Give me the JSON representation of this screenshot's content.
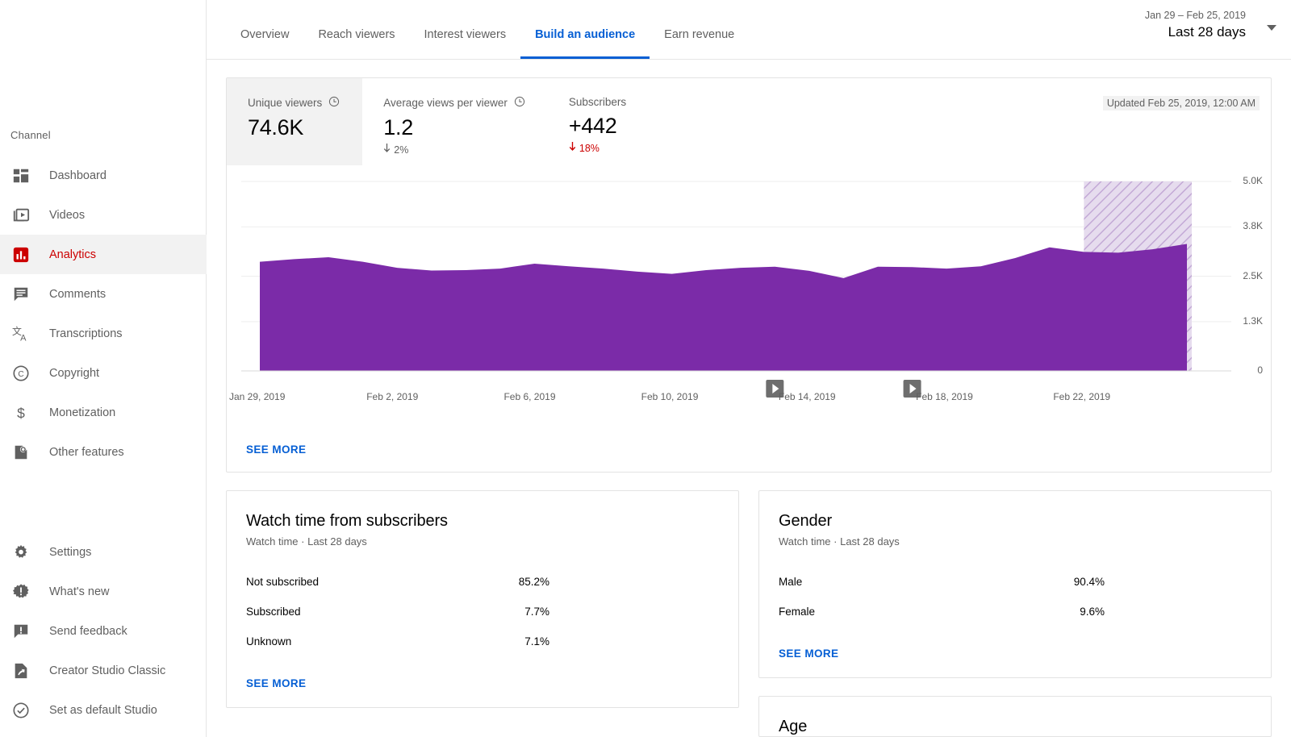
{
  "sidebar": {
    "section_label": "Channel",
    "top_items": [
      {
        "label": "Dashboard",
        "icon": "dashboard-icon",
        "active": false
      },
      {
        "label": "Videos",
        "icon": "videos-icon",
        "active": false
      },
      {
        "label": "Analytics",
        "icon": "analytics-icon",
        "active": true
      },
      {
        "label": "Comments",
        "icon": "comments-icon",
        "active": false
      },
      {
        "label": "Transcriptions",
        "icon": "transcriptions-icon",
        "active": false
      },
      {
        "label": "Copyright",
        "icon": "copyright-icon",
        "active": false
      },
      {
        "label": "Monetization",
        "icon": "monetization-icon",
        "active": false
      },
      {
        "label": "Other features",
        "icon": "other-features-icon",
        "active": false
      }
    ],
    "bottom_items": [
      {
        "label": "Settings",
        "icon": "gear-icon"
      },
      {
        "label": "What's new",
        "icon": "whats-new-icon"
      },
      {
        "label": "Send feedback",
        "icon": "feedback-icon"
      },
      {
        "label": "Creator Studio Classic",
        "icon": "creator-studio-classic-icon"
      },
      {
        "label": "Set as default Studio",
        "icon": "check-circle-icon"
      }
    ],
    "active_color": "#cc0000"
  },
  "header": {
    "tabs": [
      {
        "label": "Overview",
        "active": false
      },
      {
        "label": "Reach viewers",
        "active": false
      },
      {
        "label": "Interest viewers",
        "active": false
      },
      {
        "label": "Build an audience",
        "active": true
      },
      {
        "label": "Earn revenue",
        "active": false
      }
    ],
    "date_range_sub": "Jan 29 – Feb 25, 2019",
    "date_range_main": "Last 28 days",
    "accent_color": "#065fd4"
  },
  "chart_card": {
    "updated_text": "Updated Feb 25, 2019, 12:00 AM",
    "see_more": "SEE MORE",
    "metrics": [
      {
        "title": "Unique viewers",
        "value": "74.6K",
        "delta": "",
        "delta_dir": "",
        "has_info_icon": true,
        "selected": true
      },
      {
        "title": "Average views per viewer",
        "value": "1.2",
        "delta": "2%",
        "delta_dir": "down",
        "delta_style": "neutral",
        "has_info_icon": true,
        "selected": false
      },
      {
        "title": "Subscribers",
        "value": "+442",
        "delta": "18%",
        "delta_dir": "down",
        "delta_style": "down",
        "has_info_icon": false,
        "selected": false
      }
    ]
  },
  "chart_data": {
    "type": "area",
    "title": "Unique viewers",
    "xlabel": "",
    "ylabel": "",
    "ylim": [
      0,
      5000
    ],
    "grid": true,
    "legend": "none",
    "series_color": "#7b2ba8",
    "ytick_labels": [
      "5.0K",
      "3.8K",
      "2.5K",
      "1.3K",
      "0"
    ],
    "ytick_values": [
      5000,
      3800,
      2500,
      1300,
      0
    ],
    "xtick_labels": [
      "Jan 29, 2019",
      "Feb 2, 2019",
      "Feb 6, 2019",
      "Feb 10, 2019",
      "Feb 14, 2019",
      "Feb 18, 2019",
      "Feb 22, 2019"
    ],
    "x": [
      "Jan 29",
      "Jan 30",
      "Jan 31",
      "Feb 1",
      "Feb 2",
      "Feb 3",
      "Feb 4",
      "Feb 5",
      "Feb 6",
      "Feb 7",
      "Feb 8",
      "Feb 9",
      "Feb 10",
      "Feb 11",
      "Feb 12",
      "Feb 13",
      "Feb 14",
      "Feb 15",
      "Feb 16",
      "Feb 17",
      "Feb 18",
      "Feb 19",
      "Feb 20",
      "Feb 21",
      "Feb 22",
      "Feb 23",
      "Feb 24",
      "Feb 25"
    ],
    "values": [
      2880,
      2950,
      3000,
      2880,
      2720,
      2650,
      2660,
      2700,
      2830,
      2760,
      2700,
      2620,
      2560,
      2660,
      2720,
      2750,
      2640,
      2450,
      2750,
      2740,
      2700,
      2760,
      2980,
      3260,
      3140,
      3120,
      3210,
      3350
    ],
    "pending_region": {
      "from": "Feb 22",
      "to": "Feb 25",
      "style": "diagonal-hatch",
      "color": "#cdb8dd"
    },
    "video_markers": [
      {
        "x": "Feb 13",
        "icon": "play-marker-icon"
      },
      {
        "x": "Feb 17",
        "icon": "play-marker-icon"
      }
    ]
  },
  "watch_time_card": {
    "title": "Watch time from subscribers",
    "subtitle": "Watch time · Last 28 days",
    "see_more": "SEE MORE",
    "rows": [
      {
        "label": "Not subscribed",
        "pct": "85.2%",
        "value": 85.2
      },
      {
        "label": "Subscribed",
        "pct": "7.7%",
        "value": 7.7
      },
      {
        "label": "Unknown",
        "pct": "7.1%",
        "value": 7.1
      }
    ]
  },
  "gender_card": {
    "title": "Gender",
    "subtitle": "Watch time · Last 28 days",
    "see_more": "SEE MORE",
    "rows": [
      {
        "label": "Male",
        "pct": "90.4%",
        "value": 90.4
      },
      {
        "label": "Female",
        "pct": "9.6%",
        "value": 9.6
      }
    ]
  },
  "age_card": {
    "title": "Age"
  }
}
